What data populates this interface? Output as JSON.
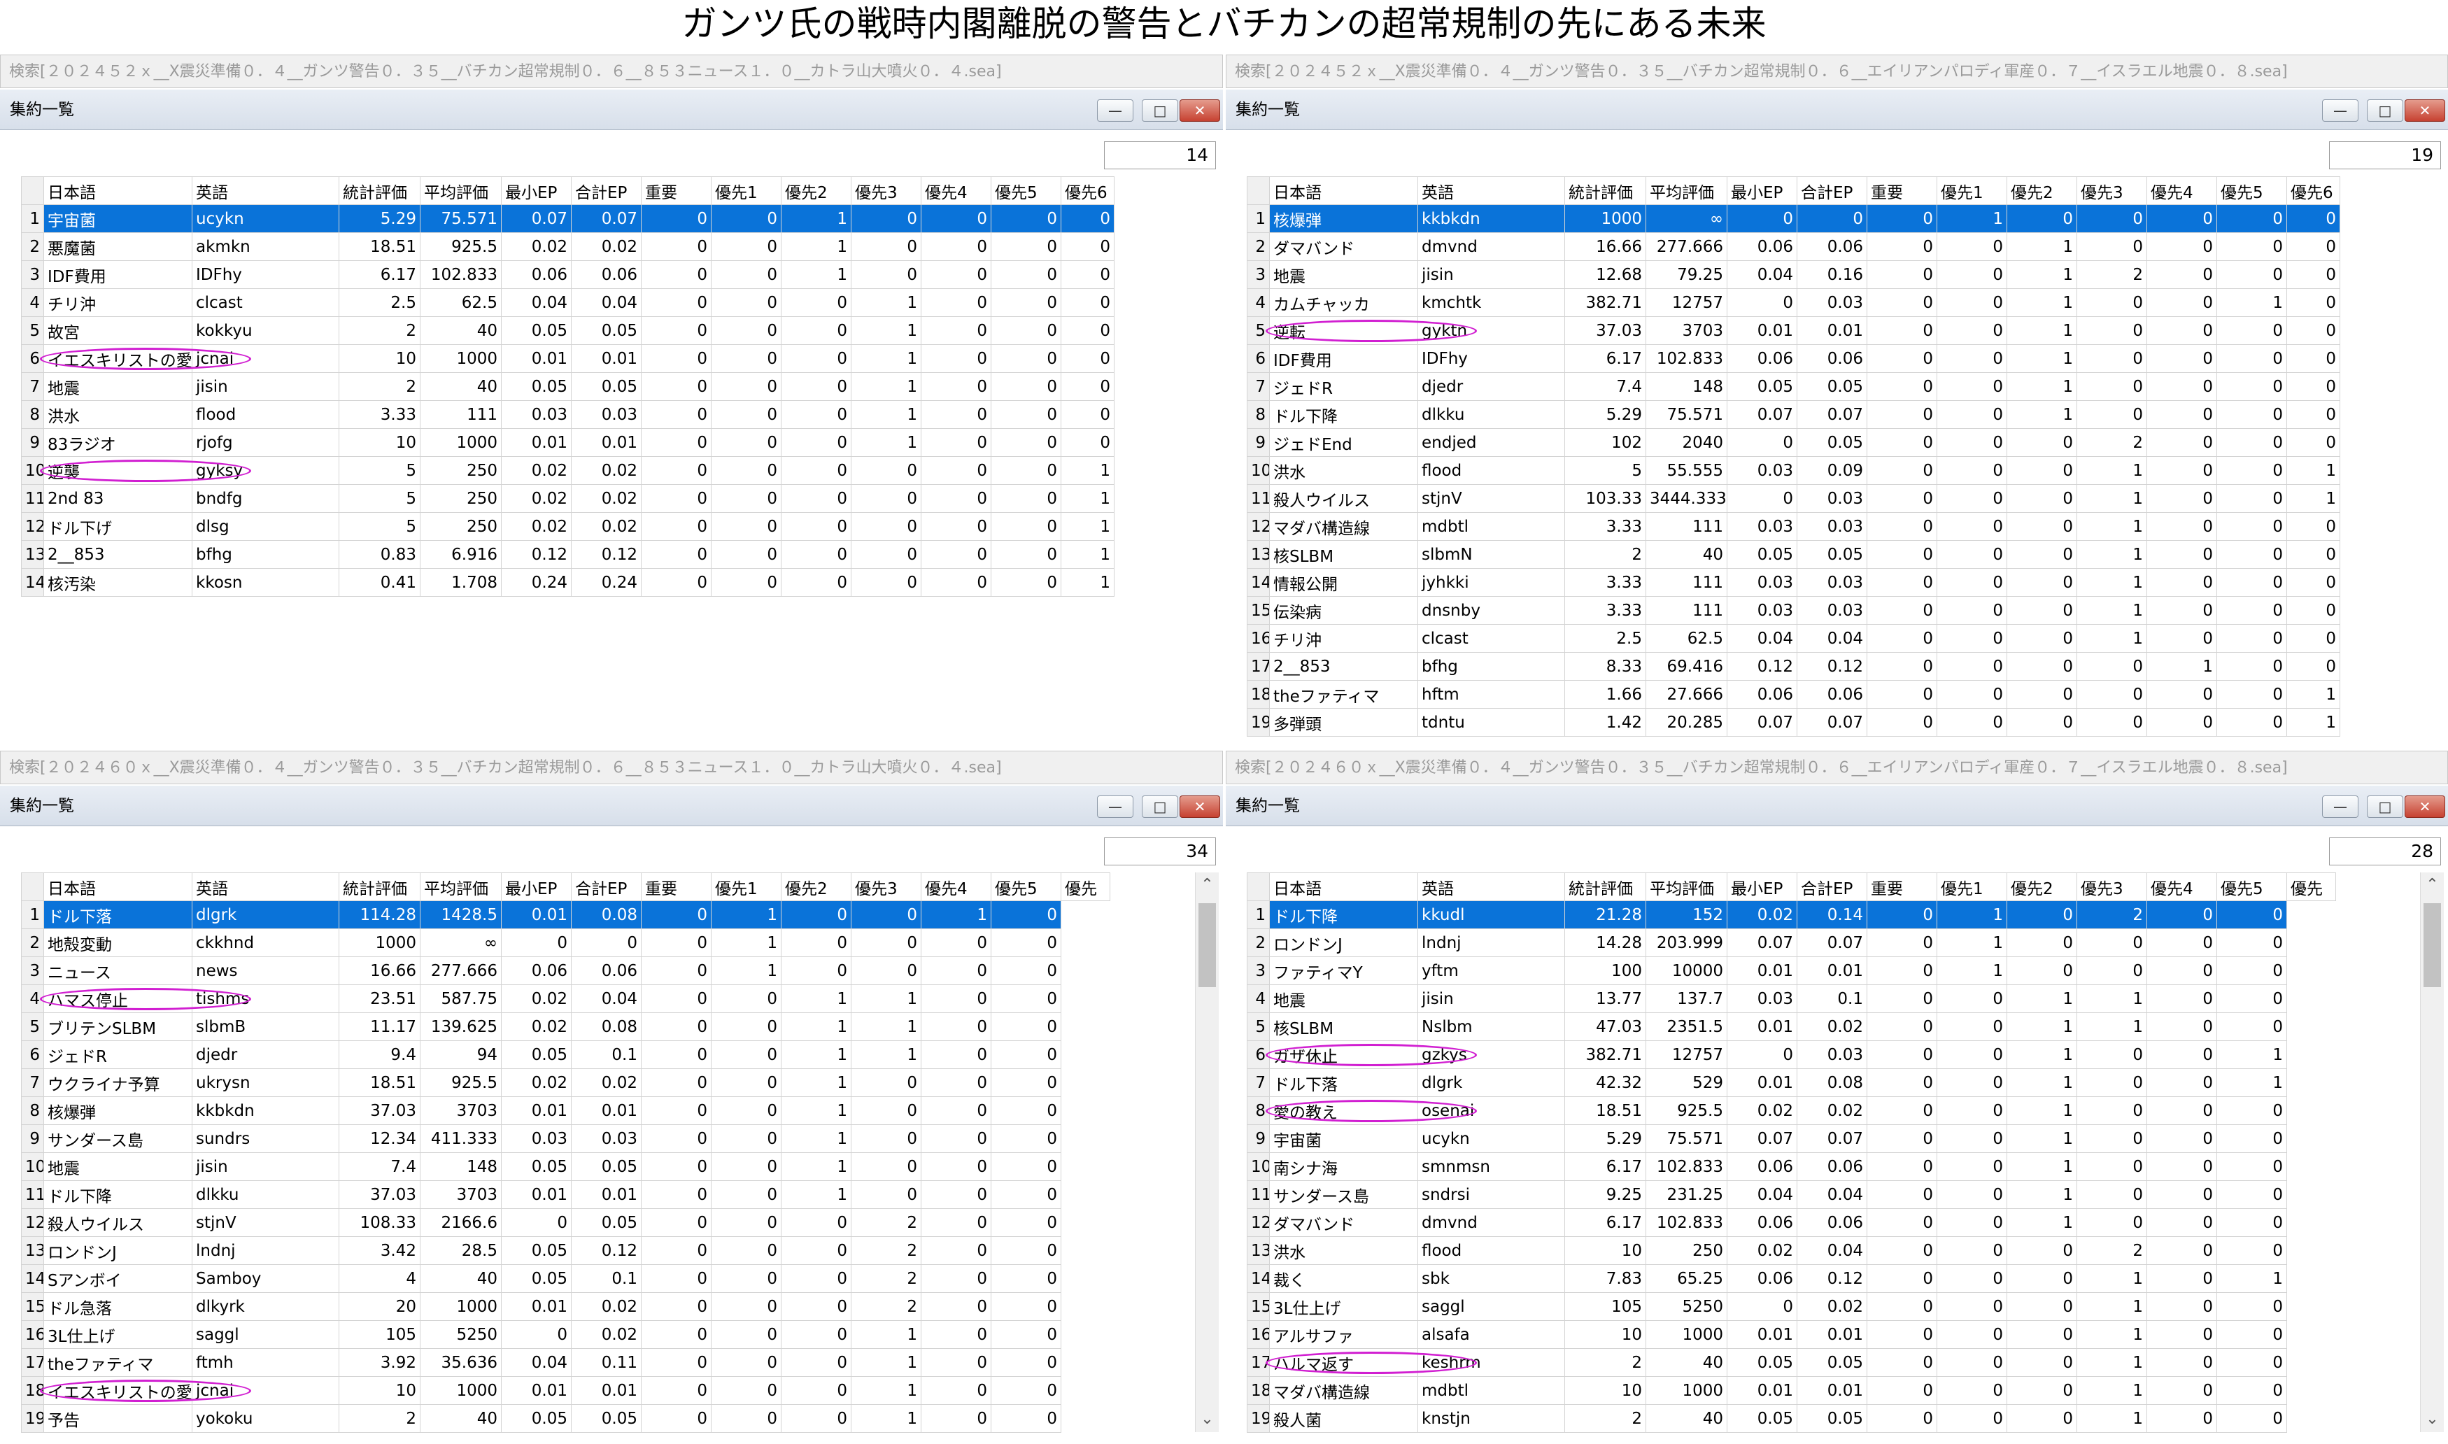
{
  "page_title": "ガンツ氏の戦時内閣離脱の警告とバチカンの超常規制の先にある未来",
  "accent_color": "#0a73d9",
  "oval_color": "#d11fd1",
  "panels": [
    {
      "search": "検索[２０２４５２ｘ__X震災準備０．４__ガンツ警告０．３５__バチカン超常規制０．６__８５３ニュース１．０__カトラ山大噴火０．４.sea]",
      "window_title": "集約一覧",
      "count": "14",
      "headers": [
        "日本語",
        "英語",
        "統計評価",
        "平均評価",
        "最小EP",
        "合計EP",
        "重要",
        "優先1",
        "優先2",
        "優先3",
        "優先4",
        "優先5",
        "優先6"
      ],
      "rows": [
        [
          "1",
          "宇宙菌",
          "ucykn",
          "5.29",
          "75.571",
          "0.07",
          "0.07",
          "0",
          "0",
          "1",
          "0",
          "0",
          "0",
          "0"
        ],
        [
          "2",
          "悪魔菌",
          "akmkn",
          "18.51",
          "925.5",
          "0.02",
          "0.02",
          "0",
          "0",
          "1",
          "0",
          "0",
          "0",
          "0"
        ],
        [
          "3",
          "IDF費用",
          "IDFhy",
          "6.17",
          "102.833",
          "0.06",
          "0.06",
          "0",
          "0",
          "1",
          "0",
          "0",
          "0",
          "0"
        ],
        [
          "4",
          "チリ沖",
          "clcast",
          "2.5",
          "62.5",
          "0.04",
          "0.04",
          "0",
          "0",
          "0",
          "1",
          "0",
          "0",
          "0"
        ],
        [
          "5",
          "故宮",
          "kokkyu",
          "2",
          "40",
          "0.05",
          "0.05",
          "0",
          "0",
          "0",
          "1",
          "0",
          "0",
          "0"
        ],
        [
          "6",
          "イエスキリストの愛",
          "jcnai",
          "10",
          "1000",
          "0.01",
          "0.01",
          "0",
          "0",
          "0",
          "1",
          "0",
          "0",
          "0"
        ],
        [
          "7",
          "地震",
          "jisin",
          "2",
          "40",
          "0.05",
          "0.05",
          "0",
          "0",
          "0",
          "1",
          "0",
          "0",
          "0"
        ],
        [
          "8",
          "洪水",
          "flood",
          "3.33",
          "111",
          "0.03",
          "0.03",
          "0",
          "0",
          "0",
          "1",
          "0",
          "0",
          "0"
        ],
        [
          "9",
          "83ラジオ",
          "rjofg",
          "10",
          "1000",
          "0.01",
          "0.01",
          "0",
          "0",
          "0",
          "1",
          "0",
          "0",
          "0"
        ],
        [
          "10",
          "逆襲",
          "gyksy",
          "5",
          "250",
          "0.02",
          "0.02",
          "0",
          "0",
          "0",
          "0",
          "0",
          "0",
          "1"
        ],
        [
          "11",
          "2nd 83",
          "bndfg",
          "5",
          "250",
          "0.02",
          "0.02",
          "0",
          "0",
          "0",
          "0",
          "0",
          "0",
          "1"
        ],
        [
          "12",
          "ドル下げ",
          "dlsg",
          "5",
          "250",
          "0.02",
          "0.02",
          "0",
          "0",
          "0",
          "0",
          "0",
          "0",
          "1"
        ],
        [
          "13",
          "2__853",
          "bfhg",
          "0.83",
          "6.916",
          "0.12",
          "0.12",
          "0",
          "0",
          "0",
          "0",
          "0",
          "0",
          "1"
        ],
        [
          "14",
          "核汚染",
          "kkosn",
          "0.41",
          "1.708",
          "0.24",
          "0.24",
          "0",
          "0",
          "0",
          "0",
          "0",
          "0",
          "1"
        ]
      ]
    },
    {
      "search": "検索[２０２４５２ｘ__X震災準備０．４__ガンツ警告０．３５__バチカン超常規制０．６__エイリアンパロディ軍産０．７__イスラエル地震０．８.sea]",
      "window_title": "集約一覧",
      "count": "19",
      "headers": [
        "日本語",
        "英語",
        "統計評価",
        "平均評価",
        "最小EP",
        "合計EP",
        "重要",
        "優先1",
        "優先2",
        "優先3",
        "優先4",
        "優先5",
        "優先6"
      ],
      "rows": [
        [
          "1",
          "核爆弾",
          "kkbkdn",
          "1000",
          "∞",
          "0",
          "0",
          "0",
          "1",
          "0",
          "0",
          "0",
          "0",
          "0"
        ],
        [
          "2",
          "ダマバンド",
          "dmvnd",
          "16.66",
          "277.666",
          "0.06",
          "0.06",
          "0",
          "0",
          "1",
          "0",
          "0",
          "0",
          "0"
        ],
        [
          "3",
          "地震",
          "jisin",
          "12.68",
          "79.25",
          "0.04",
          "0.16",
          "0",
          "0",
          "1",
          "2",
          "0",
          "0",
          "0"
        ],
        [
          "4",
          "カムチャッカ",
          "kmchtk",
          "382.71",
          "12757",
          "0",
          "0.03",
          "0",
          "0",
          "1",
          "0",
          "0",
          "1",
          "0"
        ],
        [
          "5",
          "逆転",
          "gyktn",
          "37.03",
          "3703",
          "0.01",
          "0.01",
          "0",
          "0",
          "1",
          "0",
          "0",
          "0",
          "0"
        ],
        [
          "6",
          "IDF費用",
          "IDFhy",
          "6.17",
          "102.833",
          "0.06",
          "0.06",
          "0",
          "0",
          "1",
          "0",
          "0",
          "0",
          "0"
        ],
        [
          "7",
          "ジェドR",
          "djedr",
          "7.4",
          "148",
          "0.05",
          "0.05",
          "0",
          "0",
          "1",
          "0",
          "0",
          "0",
          "0"
        ],
        [
          "8",
          "ドル下降",
          "dlkku",
          "5.29",
          "75.571",
          "0.07",
          "0.07",
          "0",
          "0",
          "1",
          "0",
          "0",
          "0",
          "0"
        ],
        [
          "9",
          "ジェドEnd",
          "endjed",
          "102",
          "2040",
          "0",
          "0.05",
          "0",
          "0",
          "0",
          "2",
          "0",
          "0",
          "0"
        ],
        [
          "10",
          "洪水",
          "flood",
          "5",
          "55.555",
          "0.03",
          "0.09",
          "0",
          "0",
          "0",
          "1",
          "0",
          "0",
          "1"
        ],
        [
          "11",
          "殺人ウイルス",
          "stjnV",
          "103.33",
          "3444.333",
          "0",
          "0.03",
          "0",
          "0",
          "0",
          "1",
          "0",
          "0",
          "1"
        ],
        [
          "12",
          "マダバ構造線",
          "mdbtl",
          "3.33",
          "111",
          "0.03",
          "0.03",
          "0",
          "0",
          "0",
          "1",
          "0",
          "0",
          "0"
        ],
        [
          "13",
          "核SLBM",
          "slbmN",
          "2",
          "40",
          "0.05",
          "0.05",
          "0",
          "0",
          "0",
          "1",
          "0",
          "0",
          "0"
        ],
        [
          "14",
          "情報公開",
          "jyhkki",
          "3.33",
          "111",
          "0.03",
          "0.03",
          "0",
          "0",
          "0",
          "1",
          "0",
          "0",
          "0"
        ],
        [
          "15",
          "伝染病",
          "dnsnby",
          "3.33",
          "111",
          "0.03",
          "0.03",
          "0",
          "0",
          "0",
          "1",
          "0",
          "0",
          "0"
        ],
        [
          "16",
          "チリ沖",
          "clcast",
          "2.5",
          "62.5",
          "0.04",
          "0.04",
          "0",
          "0",
          "0",
          "1",
          "0",
          "0",
          "0"
        ],
        [
          "17",
          "2__853",
          "bfhg",
          "8.33",
          "69.416",
          "0.12",
          "0.12",
          "0",
          "0",
          "0",
          "0",
          "1",
          "0",
          "0"
        ],
        [
          "18",
          "theファティマ",
          "hftm",
          "1.66",
          "27.666",
          "0.06",
          "0.06",
          "0",
          "0",
          "0",
          "0",
          "0",
          "0",
          "1"
        ],
        [
          "19",
          "多弾頭",
          "tdntu",
          "1.42",
          "20.285",
          "0.07",
          "0.07",
          "0",
          "0",
          "0",
          "0",
          "0",
          "0",
          "1"
        ]
      ]
    },
    {
      "search": "検索[２０２４６０ｘ__X震災準備０．４__ガンツ警告０．３５__バチカン超常規制０．６__８５３ニュース１．０__カトラ山大噴火０．４.sea]",
      "window_title": "集約一覧",
      "count": "34",
      "headers": [
        "日本語",
        "英語",
        "統計評価",
        "平均評価",
        "最小EP",
        "合計EP",
        "重要",
        "優先1",
        "優先2",
        "優先3",
        "優先4",
        "優先5",
        "優先"
      ],
      "rows": [
        [
          "1",
          "ドル下落",
          "dlgrk",
          "114.28",
          "1428.5",
          "0.01",
          "0.08",
          "0",
          "1",
          "0",
          "0",
          "1",
          "0"
        ],
        [
          "2",
          "地殻変動",
          "ckkhnd",
          "1000",
          "∞",
          "0",
          "0",
          "0",
          "1",
          "0",
          "0",
          "0",
          "0"
        ],
        [
          "3",
          "ニュース",
          "news",
          "16.66",
          "277.666",
          "0.06",
          "0.06",
          "0",
          "1",
          "0",
          "0",
          "0",
          "0"
        ],
        [
          "4",
          "ハマス停止",
          "tishms",
          "23.51",
          "587.75",
          "0.02",
          "0.04",
          "0",
          "0",
          "1",
          "1",
          "0",
          "0"
        ],
        [
          "5",
          "ブリテンSLBM",
          "slbmB",
          "11.17",
          "139.625",
          "0.02",
          "0.08",
          "0",
          "0",
          "1",
          "1",
          "0",
          "0"
        ],
        [
          "6",
          "ジェドR",
          "djedr",
          "9.4",
          "94",
          "0.05",
          "0.1",
          "0",
          "0",
          "1",
          "1",
          "0",
          "0"
        ],
        [
          "7",
          "ウクライナ予算",
          "ukrysn",
          "18.51",
          "925.5",
          "0.02",
          "0.02",
          "0",
          "0",
          "1",
          "0",
          "0",
          "0"
        ],
        [
          "8",
          "核爆弾",
          "kkbkdn",
          "37.03",
          "3703",
          "0.01",
          "0.01",
          "0",
          "0",
          "1",
          "0",
          "0",
          "0"
        ],
        [
          "9",
          "サンダース島",
          "sundrs",
          "12.34",
          "411.333",
          "0.03",
          "0.03",
          "0",
          "0",
          "1",
          "0",
          "0",
          "0"
        ],
        [
          "10",
          "地震",
          "jisin",
          "7.4",
          "148",
          "0.05",
          "0.05",
          "0",
          "0",
          "1",
          "0",
          "0",
          "0"
        ],
        [
          "11",
          "ドル下降",
          "dlkku",
          "37.03",
          "3703",
          "0.01",
          "0.01",
          "0",
          "0",
          "1",
          "0",
          "0",
          "0"
        ],
        [
          "12",
          "殺人ウイルス",
          "stjnV",
          "108.33",
          "2166.6",
          "0",
          "0.05",
          "0",
          "0",
          "0",
          "2",
          "0",
          "0"
        ],
        [
          "13",
          "ロンドンJ",
          "lndnj",
          "3.42",
          "28.5",
          "0.05",
          "0.12",
          "0",
          "0",
          "0",
          "2",
          "0",
          "0"
        ],
        [
          "14",
          "Sアンボイ",
          "Samboy",
          "4",
          "40",
          "0.05",
          "0.1",
          "0",
          "0",
          "0",
          "2",
          "0",
          "0"
        ],
        [
          "15",
          "ドル急落",
          "dlkyrk",
          "20",
          "1000",
          "0.01",
          "0.02",
          "0",
          "0",
          "0",
          "2",
          "0",
          "0"
        ],
        [
          "16",
          "3L仕上げ",
          "saggl",
          "105",
          "5250",
          "0",
          "0.02",
          "0",
          "0",
          "0",
          "1",
          "0",
          "0"
        ],
        [
          "17",
          "theファティマ",
          "ftmh",
          "3.92",
          "35.636",
          "0.04",
          "0.11",
          "0",
          "0",
          "0",
          "1",
          "0",
          "0"
        ],
        [
          "18",
          "イエスキリストの愛",
          "jcnai",
          "10",
          "1000",
          "0.01",
          "0.01",
          "0",
          "0",
          "0",
          "1",
          "0",
          "0"
        ],
        [
          "19",
          "予告",
          "yokoku",
          "2",
          "40",
          "0.05",
          "0.05",
          "0",
          "0",
          "0",
          "1",
          "0",
          "0"
        ]
      ]
    },
    {
      "search": "検索[２０２４６０ｘ__X震災準備０．４__ガンツ警告０．３５__バチカン超常規制０．６__エイリアンパロディ軍産０．７__イスラエル地震０．８.sea]",
      "window_title": "集約一覧",
      "count": "28",
      "headers": [
        "日本語",
        "英語",
        "統計評価",
        "平均評価",
        "最小EP",
        "合計EP",
        "重要",
        "優先1",
        "優先2",
        "優先3",
        "優先4",
        "優先5",
        "優先"
      ],
      "rows": [
        [
          "1",
          "ドル下降",
          "kkudl",
          "21.28",
          "152",
          "0.02",
          "0.14",
          "0",
          "1",
          "0",
          "2",
          "0",
          "0"
        ],
        [
          "2",
          "ロンドンJ",
          "lndnj",
          "14.28",
          "203.999",
          "0.07",
          "0.07",
          "0",
          "1",
          "0",
          "0",
          "0",
          "0"
        ],
        [
          "3",
          "ファティマY",
          "yftm",
          "100",
          "10000",
          "0.01",
          "0.01",
          "0",
          "1",
          "0",
          "0",
          "0",
          "0"
        ],
        [
          "4",
          "地震",
          "jisin",
          "13.77",
          "137.7",
          "0.03",
          "0.1",
          "0",
          "0",
          "1",
          "1",
          "0",
          "0"
        ],
        [
          "5",
          "核SLBM",
          "Nslbm",
          "47.03",
          "2351.5",
          "0.01",
          "0.02",
          "0",
          "0",
          "1",
          "1",
          "0",
          "0"
        ],
        [
          "6",
          "ガザ休止",
          "gzkys",
          "382.71",
          "12757",
          "0",
          "0.03",
          "0",
          "0",
          "1",
          "0",
          "0",
          "1"
        ],
        [
          "7",
          "ドル下落",
          "dlgrk",
          "42.32",
          "529",
          "0.01",
          "0.08",
          "0",
          "0",
          "1",
          "0",
          "0",
          "1"
        ],
        [
          "8",
          "愛の教え",
          "osenai",
          "18.51",
          "925.5",
          "0.02",
          "0.02",
          "0",
          "0",
          "1",
          "0",
          "0",
          "0"
        ],
        [
          "9",
          "宇宙菌",
          "ucykn",
          "5.29",
          "75.571",
          "0.07",
          "0.07",
          "0",
          "0",
          "1",
          "0",
          "0",
          "0"
        ],
        [
          "10",
          "南シナ海",
          "smnmsn",
          "6.17",
          "102.833",
          "0.06",
          "0.06",
          "0",
          "0",
          "1",
          "0",
          "0",
          "0"
        ],
        [
          "11",
          "サンダース島",
          "sndrsi",
          "9.25",
          "231.25",
          "0.04",
          "0.04",
          "0",
          "0",
          "1",
          "0",
          "0",
          "0"
        ],
        [
          "12",
          "ダマバンド",
          "dmvnd",
          "6.17",
          "102.833",
          "0.06",
          "0.06",
          "0",
          "0",
          "1",
          "0",
          "0",
          "0"
        ],
        [
          "13",
          "洪水",
          "flood",
          "10",
          "250",
          "0.02",
          "0.04",
          "0",
          "0",
          "0",
          "2",
          "0",
          "0"
        ],
        [
          "14",
          "裁く",
          "sbk",
          "7.83",
          "65.25",
          "0.06",
          "0.12",
          "0",
          "0",
          "0",
          "1",
          "0",
          "1"
        ],
        [
          "15",
          "3L仕上げ",
          "saggl",
          "105",
          "5250",
          "0",
          "0.02",
          "0",
          "0",
          "0",
          "1",
          "0",
          "0"
        ],
        [
          "16",
          "アルサファ",
          "alsafa",
          "10",
          "1000",
          "0.01",
          "0.01",
          "0",
          "0",
          "0",
          "1",
          "0",
          "0"
        ],
        [
          "17",
          "ハルマ返す",
          "keshrm",
          "2",
          "40",
          "0.05",
          "0.05",
          "0",
          "0",
          "0",
          "1",
          "0",
          "0"
        ],
        [
          "18",
          "マダバ構造線",
          "mdbtl",
          "10",
          "1000",
          "0.01",
          "0.01",
          "0",
          "0",
          "0",
          "1",
          "0",
          "0"
        ],
        [
          "19",
          "殺人菌",
          "knstjn",
          "2",
          "40",
          "0.05",
          "0.05",
          "0",
          "0",
          "0",
          "1",
          "0",
          "0"
        ]
      ]
    }
  ],
  "highlights": [
    {
      "panel": 0,
      "row": "6"
    },
    {
      "panel": 0,
      "row": "10"
    },
    {
      "panel": 1,
      "row": "5"
    },
    {
      "panel": 2,
      "row": "4"
    },
    {
      "panel": 2,
      "row": "18"
    },
    {
      "panel": 3,
      "row": "6"
    },
    {
      "panel": 3,
      "row": "8"
    },
    {
      "panel": 3,
      "row": "17"
    }
  ],
  "icons": {
    "minimize": "minimize-icon",
    "maximize": "maximize-icon",
    "close": "close-icon",
    "scroll_up": "scroll-up-icon",
    "scroll_down": "scroll-down-icon"
  }
}
